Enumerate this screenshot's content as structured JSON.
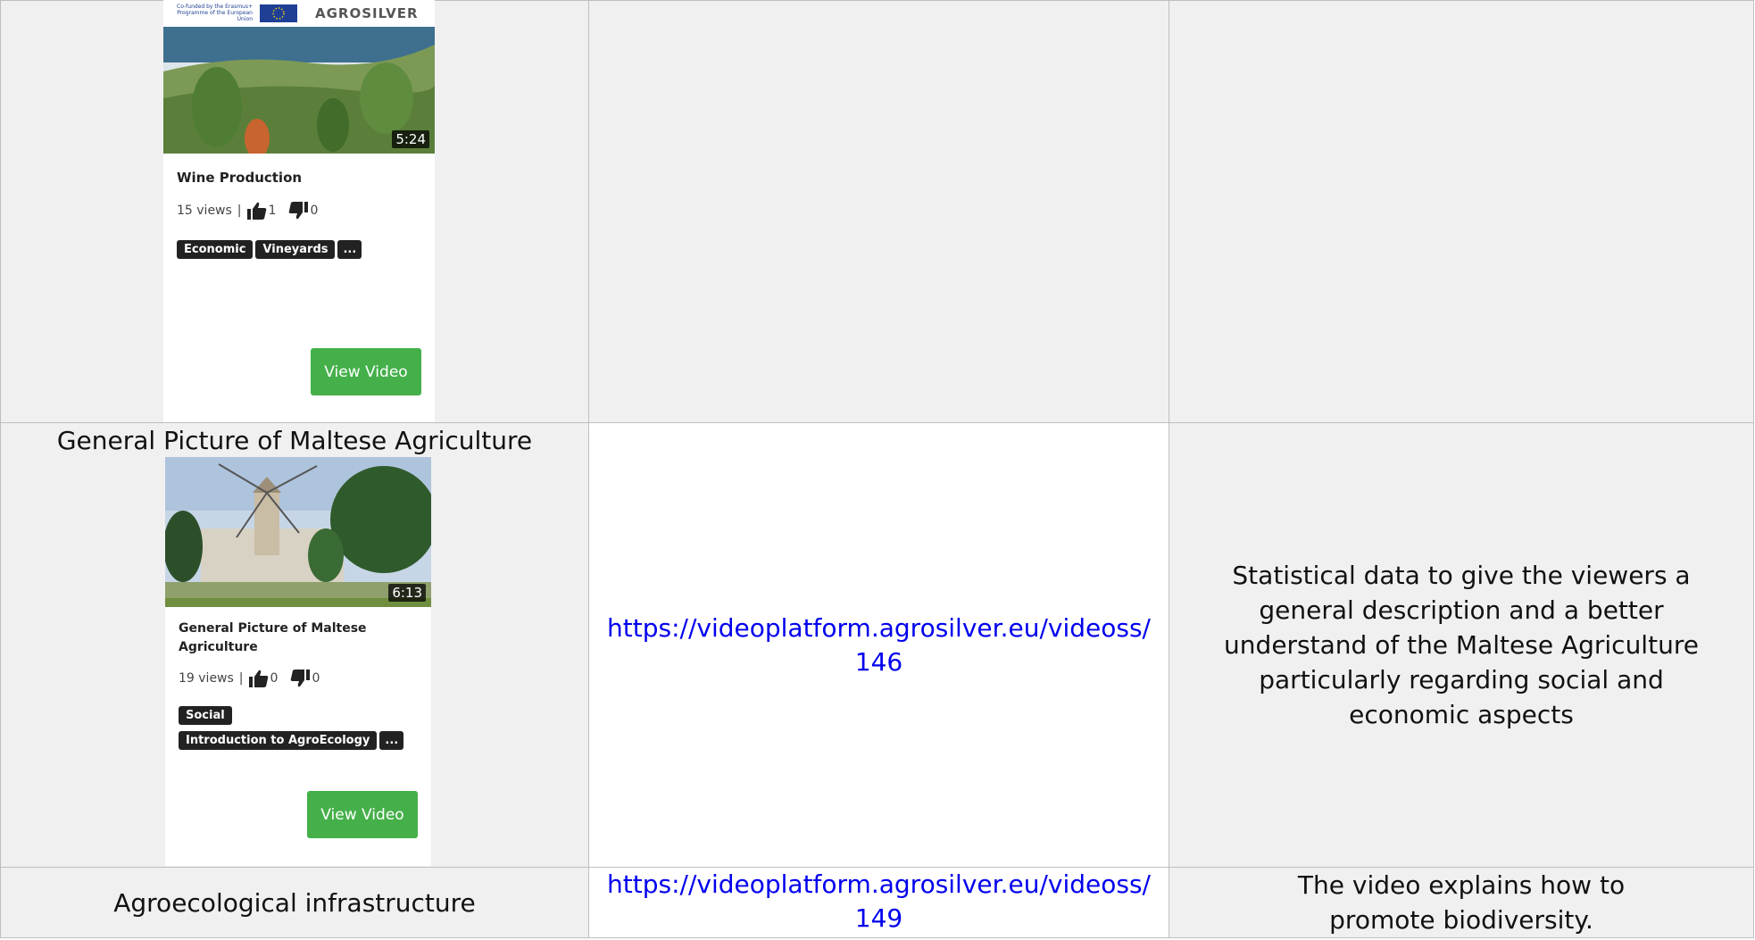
{
  "rows": [
    {
      "title": "",
      "card": {
        "duration": "5:24",
        "video_title": "Wine Production",
        "views": "15 views",
        "separator": "|",
        "likes": "1",
        "dislikes": "0",
        "tags": [
          "Economic",
          "Vineyards"
        ],
        "more_tag": "...",
        "button_label": "View Video",
        "logo_text": "AGROSILVER",
        "eu_text": "Co-funded by the Erasmus+ Programme of the European Union"
      },
      "link": "",
      "description": ""
    },
    {
      "title": "General Picture of Maltese Agriculture",
      "card": {
        "duration": "6:13",
        "video_title": "General Picture of Maltese Agriculture",
        "views": "19 views",
        "separator": "|",
        "likes": "0",
        "dislikes": "0",
        "tags": [
          "Social",
          "Introduction to AgroEcology"
        ],
        "more_tag": "...",
        "button_label": "View Video"
      },
      "link": "https://videoplatform.agrosilver.eu/videoss/146",
      "description": "Statistical data to give the viewers a general description and a better understand of the Maltese Agriculture particularly regarding social and economic aspects"
    },
    {
      "title": "Agroecological infrastructure",
      "link": "https://videoplatform.agrosilver.eu/videoss/149",
      "description": "The video explains how to promote biodiversity."
    }
  ],
  "colors": {
    "link": "#0000ee",
    "button": "#45b04a",
    "tag_bg": "#222222",
    "cell_grey": "#f0f0f0"
  },
  "icons": [
    "thumbs-up-icon",
    "thumbs-down-icon"
  ]
}
